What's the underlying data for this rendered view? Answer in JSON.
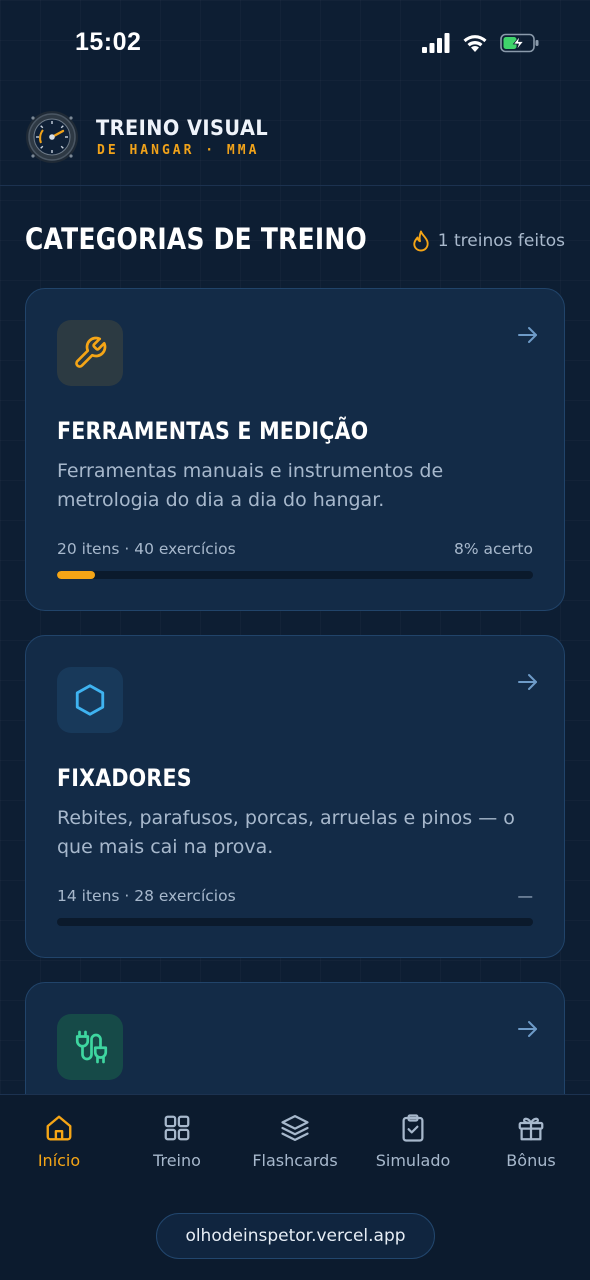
{
  "status_bar": {
    "time": "15:02"
  },
  "header": {
    "title": "TREINO VISUAL",
    "subtitle": "DE HANGAR · MMA"
  },
  "section": {
    "title": "CATEGORIAS DE TREINO",
    "streak_text": "1 treinos feitos"
  },
  "categories": [
    {
      "icon": "wrench-icon",
      "title": "FERRAMENTAS E MEDIÇÃO",
      "description": "Ferramentas manuais e instrumentos de metrologia do dia a dia do hangar.",
      "stats": "20 itens · 40 exercícios",
      "accuracy": "8% acerto",
      "progress": 0.08,
      "accent": "#f5a516"
    },
    {
      "icon": "hexagon-icon",
      "title": "FIXADORES",
      "description": "Rebites, parafusos, porcas, arruelas e pinos — o que mais cai na prova.",
      "stats": "14 itens · 28 exercícios",
      "accuracy": "—",
      "progress": 0,
      "accent": "#3fb3f0"
    },
    {
      "icon": "plug-icon",
      "accent": "#3ed6a0"
    }
  ],
  "nav": [
    {
      "label": "Início",
      "icon": "home-icon",
      "active": true
    },
    {
      "label": "Treino",
      "icon": "grid-icon",
      "active": false
    },
    {
      "label": "Flashcards",
      "icon": "layers-icon",
      "active": false
    },
    {
      "label": "Simulado",
      "icon": "clipboard-check-icon",
      "active": false
    },
    {
      "label": "Bônus",
      "icon": "gift-icon",
      "active": false
    }
  ],
  "url": "olhodeinspetor.vercel.app",
  "colors": {
    "background": "#0d1e33",
    "card": "#132b47",
    "accent": "#f5a516",
    "muted_text": "#a7b8cc"
  }
}
